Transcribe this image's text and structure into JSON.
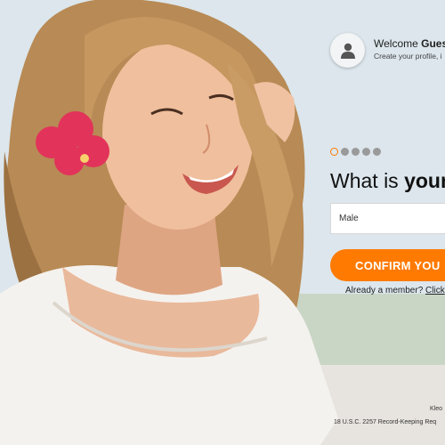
{
  "welcome": {
    "prefix": "Welcome ",
    "name": "Guest",
    "subtitle": "Create your profile, i",
    "avatar_icon": "user-icon"
  },
  "steps": {
    "total": 5,
    "current": 1,
    "accent": "#ff7a00"
  },
  "question": {
    "prefix": "What is ",
    "emphasis": "your"
  },
  "select": {
    "value": "Male"
  },
  "confirm": {
    "label": "CONFIRM YOU",
    "color": "#ff7a00"
  },
  "member": {
    "text": "Already a member? ",
    "link": "Click"
  },
  "footer": {
    "brand": "Kleo",
    "legal": "18 U.S.C. 2257 Record-Keeping Req"
  }
}
